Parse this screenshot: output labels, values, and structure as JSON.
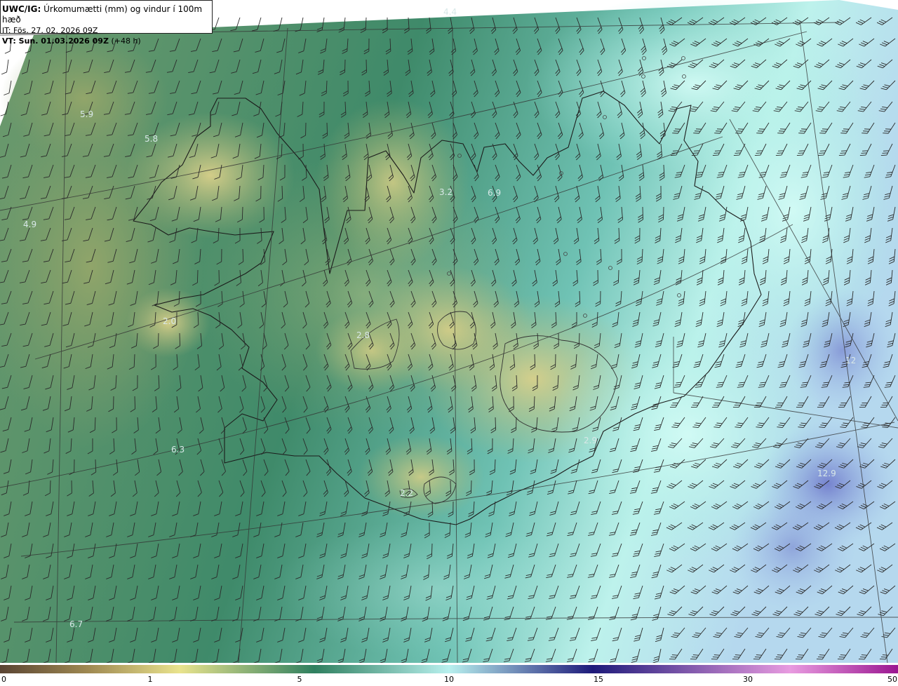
{
  "header": {
    "product": "UWC/IG:",
    "description": "Úrkomumætti (mm) og vindur í 100m hæð",
    "issue_time": "IT: Fös. 27. 02. 2026 09Z",
    "valid_label": "VT: Sun. 01.03.2026 09Z",
    "lead_time": "(+48 h)"
  },
  "map": {
    "region": "Iceland",
    "field": "precipitable water (mm)",
    "wind_barbs": true,
    "value_labels": [
      {
        "text": "4.4"
      },
      {
        "text": "5.9"
      },
      {
        "text": "5.8"
      },
      {
        "text": "4.9"
      },
      {
        "text": "2.0"
      },
      {
        "text": "3.2"
      },
      {
        "text": "6.9"
      },
      {
        "text": "2.8"
      },
      {
        "text": "6.3"
      },
      {
        "text": "2.9"
      },
      {
        "text": "12"
      },
      {
        "text": "12.9"
      },
      {
        "text": "6.7"
      },
      {
        "text": "2.2"
      }
    ]
  },
  "colorbar": {
    "ticks": [
      "0",
      "1",
      "5",
      "10",
      "15",
      "30",
      "50"
    ],
    "colors": [
      "#5a4433",
      "#a08a52",
      "#e9e38d",
      "#2f7f5f",
      "#b8f0ee",
      "#1e1a7a",
      "#e89be0",
      "#9a1690"
    ]
  }
}
